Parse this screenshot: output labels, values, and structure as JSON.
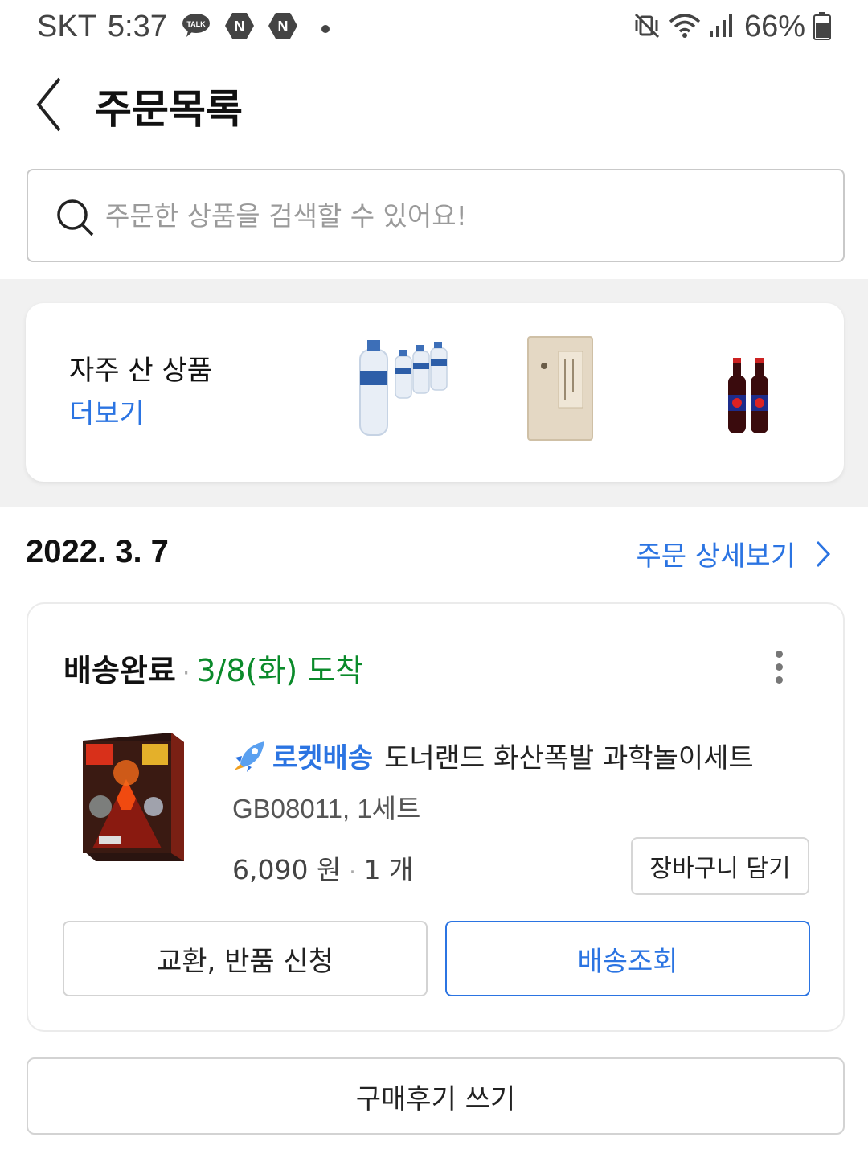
{
  "status_bar": {
    "carrier": "SKT",
    "time": "5:37",
    "notification_icons": [
      "kakaotalk-icon",
      "naver-icon",
      "naver-icon"
    ],
    "battery_percent": "66%"
  },
  "header": {
    "title": "주문목록"
  },
  "search": {
    "placeholder": "주문한 상품을 검색할 수 있어요!"
  },
  "frequent": {
    "title": "자주 산 상품",
    "more_label": "더보기",
    "items": [
      "water-bottle-pack-image",
      "rice-bag-image",
      "cola-bottles-image"
    ]
  },
  "order": {
    "date": "2022. 3. 7",
    "detail_link": "주문 상세보기",
    "status": "배송완료",
    "status_separator": "·",
    "arrival": "3/8(화) 도착",
    "product": {
      "badge": "로켓배송",
      "name": "도너랜드 화산폭발 과학놀이세트",
      "option": "GB08011, 1세트",
      "price": "6,090 원",
      "separator": "·",
      "quantity": "1 개"
    },
    "cart_button": "장바구니 담기",
    "return_button": "교환, 반품 신청",
    "track_button": "배송조회"
  },
  "review_button": "구매후기 쓰기",
  "colors": {
    "accent_blue": "#2b74e2",
    "arrival_green": "#0a8a2a",
    "band_gray": "#f1f1f1"
  }
}
